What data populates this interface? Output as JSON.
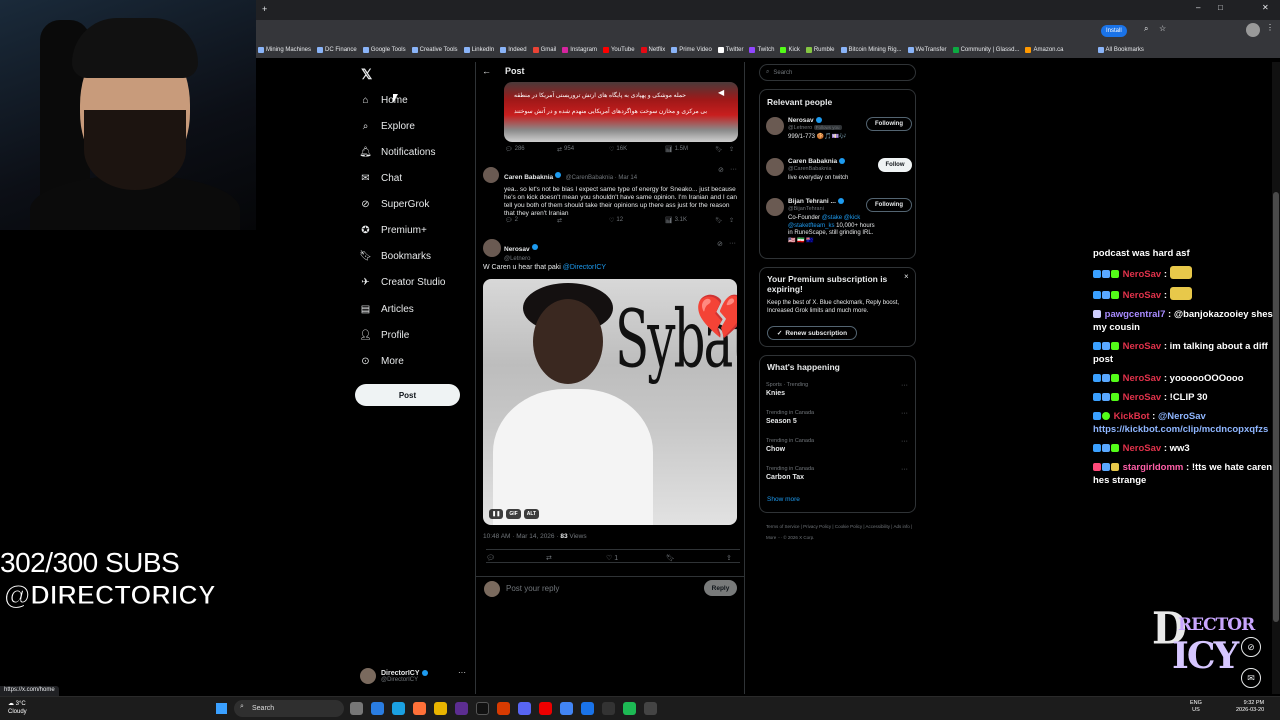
{
  "browser": {
    "install_label": "Install",
    "bookmarks": [
      "Mining Machines",
      "DC Finance",
      "Google Tools",
      "Creative Tools",
      "LinkedIn",
      "Indeed",
      "Gmail",
      "Instagram",
      "YouTube",
      "Netflix",
      "Prime Video",
      "Twitter",
      "Twitch",
      "Kick",
      "Rumble",
      "Bitcoin Mining Rig...",
      "WeTransfer",
      "Community | Glassd...",
      "Amazon.ca",
      "All Bookmarks"
    ],
    "status_url": "https://x.com/home"
  },
  "nav": {
    "items": [
      {
        "label": "Home",
        "icon": "home-icon"
      },
      {
        "label": "Explore",
        "icon": "search-icon"
      },
      {
        "label": "Notifications",
        "icon": "bell-icon"
      },
      {
        "label": "Chat",
        "icon": "mail-icon"
      },
      {
        "label": "SuperGrok",
        "icon": "grok-icon"
      },
      {
        "label": "Premium+",
        "icon": "x-premium-icon"
      },
      {
        "label": "Bookmarks",
        "icon": "bookmark-icon"
      },
      {
        "label": "Creator Studio",
        "icon": "rocket-icon"
      },
      {
        "label": "Articles",
        "icon": "article-icon"
      },
      {
        "label": "Profile",
        "icon": "person-icon"
      },
      {
        "label": "More",
        "icon": "more-circle-icon"
      }
    ],
    "post_button": "Post",
    "account": {
      "name": "DirectorICY",
      "handle": "@DirectorICY"
    }
  },
  "post": {
    "header": "Post",
    "quoted_image_text_1": "حمله موشکی و پهپادی به پایگاه های ارتش تروریستی آمریکا در منطقه",
    "quoted_image_text_2": "بی مرکزی و مخازن سوخت هواگردهای آمریکایی منهدم شده و در آتش سوختند",
    "top_actions": {
      "replies": "286",
      "reposts": "954",
      "likes": "16K",
      "views": "1.5M"
    },
    "reply": {
      "name": "Caren Babaknia",
      "handle": "@CarenBabaknia · Mar 14",
      "text": "yea.. so let's not be bias I expect same type of energy for Sneako... just because he's on kick doesn't mean you shouldn't have same opinion. I'm Iranian and I can tell you both of them should take their opinions up there ass just for the reason that they aren't Iranian",
      "replies": "2",
      "likes": "12",
      "views": "3.1K"
    },
    "main": {
      "name": "Nerosav",
      "handle": "@Letnero",
      "text": "W Caren u hear that paki",
      "mention": "@DirectorICY",
      "gif_text": "Sybau",
      "gif_heart": "💔",
      "gif_badge": "GIF",
      "alt_badge": "ALT",
      "timestamp": "10:48 AM · Mar 14, 2026 · ",
      "views": "83",
      "views_label": " Views",
      "likes": "1"
    },
    "reply_placeholder": "Post your reply",
    "reply_button": "Reply"
  },
  "sidebar": {
    "search_placeholder": "Search",
    "relevant_title": "Relevant people",
    "people": [
      {
        "name": "Nerosav",
        "handle": "@Letnero",
        "extra": "Follows you",
        "bio": "999/1-773 🍪🎵💷🎶",
        "button": "Following"
      },
      {
        "name": "Caren Babaknia",
        "handle": "@CarenBabaknia",
        "bio": "live everyday on twitch",
        "button": "Follow"
      },
      {
        "name": "Bijan Tehrani ...",
        "handle": "@BijanTehrani",
        "bio_prefix": "Co-Founder ",
        "bio_links": "@stake @kick @staketfteam_ks",
        "bio_suffix": " 10,000+ hours in RuneScape, still grinding IRL. 🇺🇸 🇮🇷 🇦🇺",
        "button": "Following"
      }
    ],
    "premium": {
      "title": "Your Premium subscription is expiring!",
      "body": "Keep the best of X. Blue checkmark, Reply boost, Increased Grok limits and much more.",
      "button": "Renew subscription"
    },
    "happening_title": "What's happening",
    "trends": [
      {
        "context": "Sports · Trending",
        "title": "Knies"
      },
      {
        "context": "Trending in Canada",
        "title": "Season 5"
      },
      {
        "context": "Trending in Canada",
        "title": "Chow"
      },
      {
        "context": "Trending in Canada",
        "title": "Carbon Tax"
      }
    ],
    "show_more": "Show more",
    "footer": "Terms of Service | Privacy Policy | Cookie Policy | Accessibility | Ads info | More ··· © 2026 X Corp."
  },
  "chat": [
    {
      "type": "text",
      "text": "podcast was hard asf"
    },
    {
      "user": "NeroSav",
      "color": "red",
      "msg": "",
      "emote": true
    },
    {
      "user": "NeroSav",
      "color": "red",
      "msg": "",
      "emote": true
    },
    {
      "user": "pawgcentral7",
      "color": "purple",
      "msg": "@banjokazooiey shes my cousin"
    },
    {
      "user": "NeroSav",
      "color": "red",
      "msg": "im talking about a diff post"
    },
    {
      "user": "NeroSav",
      "color": "red",
      "msg": "yoooooOOOooo"
    },
    {
      "user": "NeroSav",
      "color": "red",
      "msg": "!CLIP 30"
    },
    {
      "user": "KickBot",
      "color": "red",
      "msg": "@NeroSav https://kickbot.com/clip/mcdncopxqfzs"
    },
    {
      "user": "NeroSav",
      "color": "red",
      "msg": "ww3"
    },
    {
      "user": "stargirldomm",
      "color": "pink",
      "msg": "!tts we hate caren hes strange"
    }
  ],
  "overlay": {
    "subs": "302/300 SUBS",
    "handle": "@DIRECTORICY",
    "logo_d": "D",
    "logo_rector": "RECTOR",
    "logo_icy": "ICY"
  },
  "taskbar": {
    "temp": "3°C",
    "weather": "Cloudy",
    "search": "Search",
    "lang": "ENG",
    "region": "US",
    "time": "9:32 PM",
    "date": "2026-03-20"
  },
  "colors": {
    "accent": "#1d9bf0",
    "chat_red": "#e0324b",
    "chat_purple": "#a88bff",
    "chat_pink": "#ff5fa8"
  }
}
